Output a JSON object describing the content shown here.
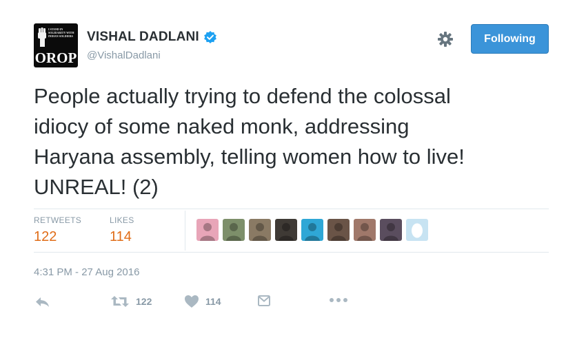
{
  "user": {
    "name": "VISHAL DADLANI",
    "handle": "@VishalDadlani",
    "avatar_text_small": "I stand in solidarity with Indian soldiers",
    "avatar_text_big": "OROP",
    "verified": true
  },
  "header": {
    "gear_icon": "gear-icon",
    "follow_label": "Following"
  },
  "tweet": {
    "lines": [
      "People actually trying to defend the colossal",
      "idiocy of some naked monk, addressing",
      "Haryana assembly, telling women how to live!",
      "UNREAL! (2)"
    ],
    "timestamp": "4:31 PM - 27 Aug 2016"
  },
  "stats": {
    "retweets_label": "RETWEETS",
    "retweets_count": "122",
    "likes_label": "LIKES",
    "likes_count": "114"
  },
  "likers": [
    {
      "name": "liker-avatar-1",
      "bg": "#e8a5b8"
    },
    {
      "name": "liker-avatar-2",
      "bg": "#7d8f6a"
    },
    {
      "name": "liker-avatar-3",
      "bg": "#8a7a64"
    },
    {
      "name": "liker-avatar-4",
      "bg": "#3f3a35"
    },
    {
      "name": "liker-avatar-5",
      "bg": "#2fa7d6"
    },
    {
      "name": "liker-avatar-6",
      "bg": "#6a5447"
    },
    {
      "name": "liker-avatar-7",
      "bg": "#a0786a"
    },
    {
      "name": "liker-avatar-8",
      "bg": "#5a4d5e"
    },
    {
      "name": "liker-avatar-egg",
      "bg": "#c7e3f2"
    }
  ],
  "actions": {
    "reply_icon": "reply-icon",
    "retweet_icon": "retweet-icon",
    "retweet_count": "122",
    "like_icon": "heart-icon",
    "like_count": "114",
    "dm_icon": "direct-message-icon",
    "more_icon": "more-dots-icon"
  },
  "colors": {
    "accent": "#3b94d9",
    "count": "#e06c17",
    "muted": "#8899a6"
  }
}
